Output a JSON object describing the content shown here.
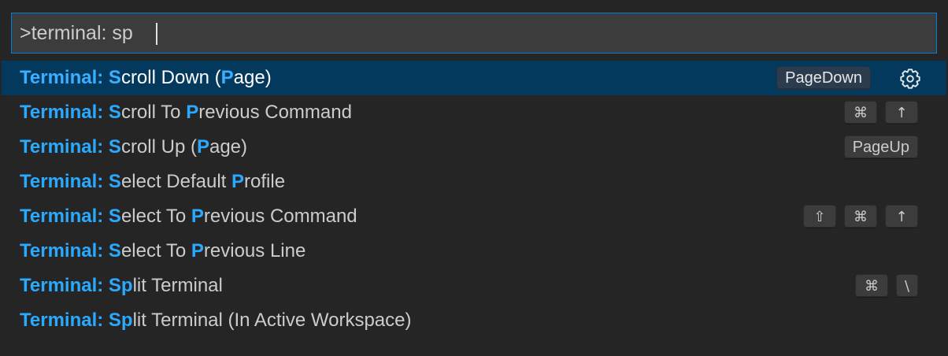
{
  "search": {
    "value": ">terminal: sp",
    "placeholder": ""
  },
  "colors": {
    "accent": "#2aaaff",
    "selected_bg": "#04395e",
    "focus_border": "#007fd4"
  },
  "items": [
    {
      "prefix": "Terminal: ",
      "parts": [
        [
          "S",
          true
        ],
        [
          "croll Down (",
          false
        ],
        [
          "P",
          true
        ],
        [
          "age)",
          false
        ]
      ],
      "keys": [
        "PageDown"
      ],
      "selected": true,
      "action_icon": "gear-icon"
    },
    {
      "prefix": "Terminal: ",
      "parts": [
        [
          "S",
          true
        ],
        [
          "croll To ",
          false
        ],
        [
          "P",
          true
        ],
        [
          "revious Command",
          false
        ]
      ],
      "keys": [
        "⌘",
        "↑"
      ]
    },
    {
      "prefix": "Terminal: ",
      "parts": [
        [
          "S",
          true
        ],
        [
          "croll Up (",
          false
        ],
        [
          "P",
          true
        ],
        [
          "age)",
          false
        ]
      ],
      "keys": [
        "PageUp"
      ]
    },
    {
      "prefix": "Terminal: ",
      "parts": [
        [
          "S",
          true
        ],
        [
          "elect Default ",
          false
        ],
        [
          "P",
          true
        ],
        [
          "rofile",
          false
        ]
      ],
      "keys": []
    },
    {
      "prefix": "Terminal: ",
      "parts": [
        [
          "S",
          true
        ],
        [
          "elect To ",
          false
        ],
        [
          "P",
          true
        ],
        [
          "revious Command",
          false
        ]
      ],
      "keys": [
        "⇧",
        "⌘",
        "↑"
      ]
    },
    {
      "prefix": "Terminal: ",
      "parts": [
        [
          "S",
          true
        ],
        [
          "elect To ",
          false
        ],
        [
          "P",
          true
        ],
        [
          "revious Line",
          false
        ]
      ],
      "keys": []
    },
    {
      "prefix": "Terminal: ",
      "parts": [
        [
          "Sp",
          true
        ],
        [
          "lit Terminal",
          false
        ]
      ],
      "keys": [
        "⌘",
        "\\"
      ]
    },
    {
      "prefix": "Terminal: ",
      "parts": [
        [
          "Sp",
          true
        ],
        [
          "lit Terminal (In Active Workspace)",
          false
        ]
      ],
      "keys": []
    }
  ]
}
